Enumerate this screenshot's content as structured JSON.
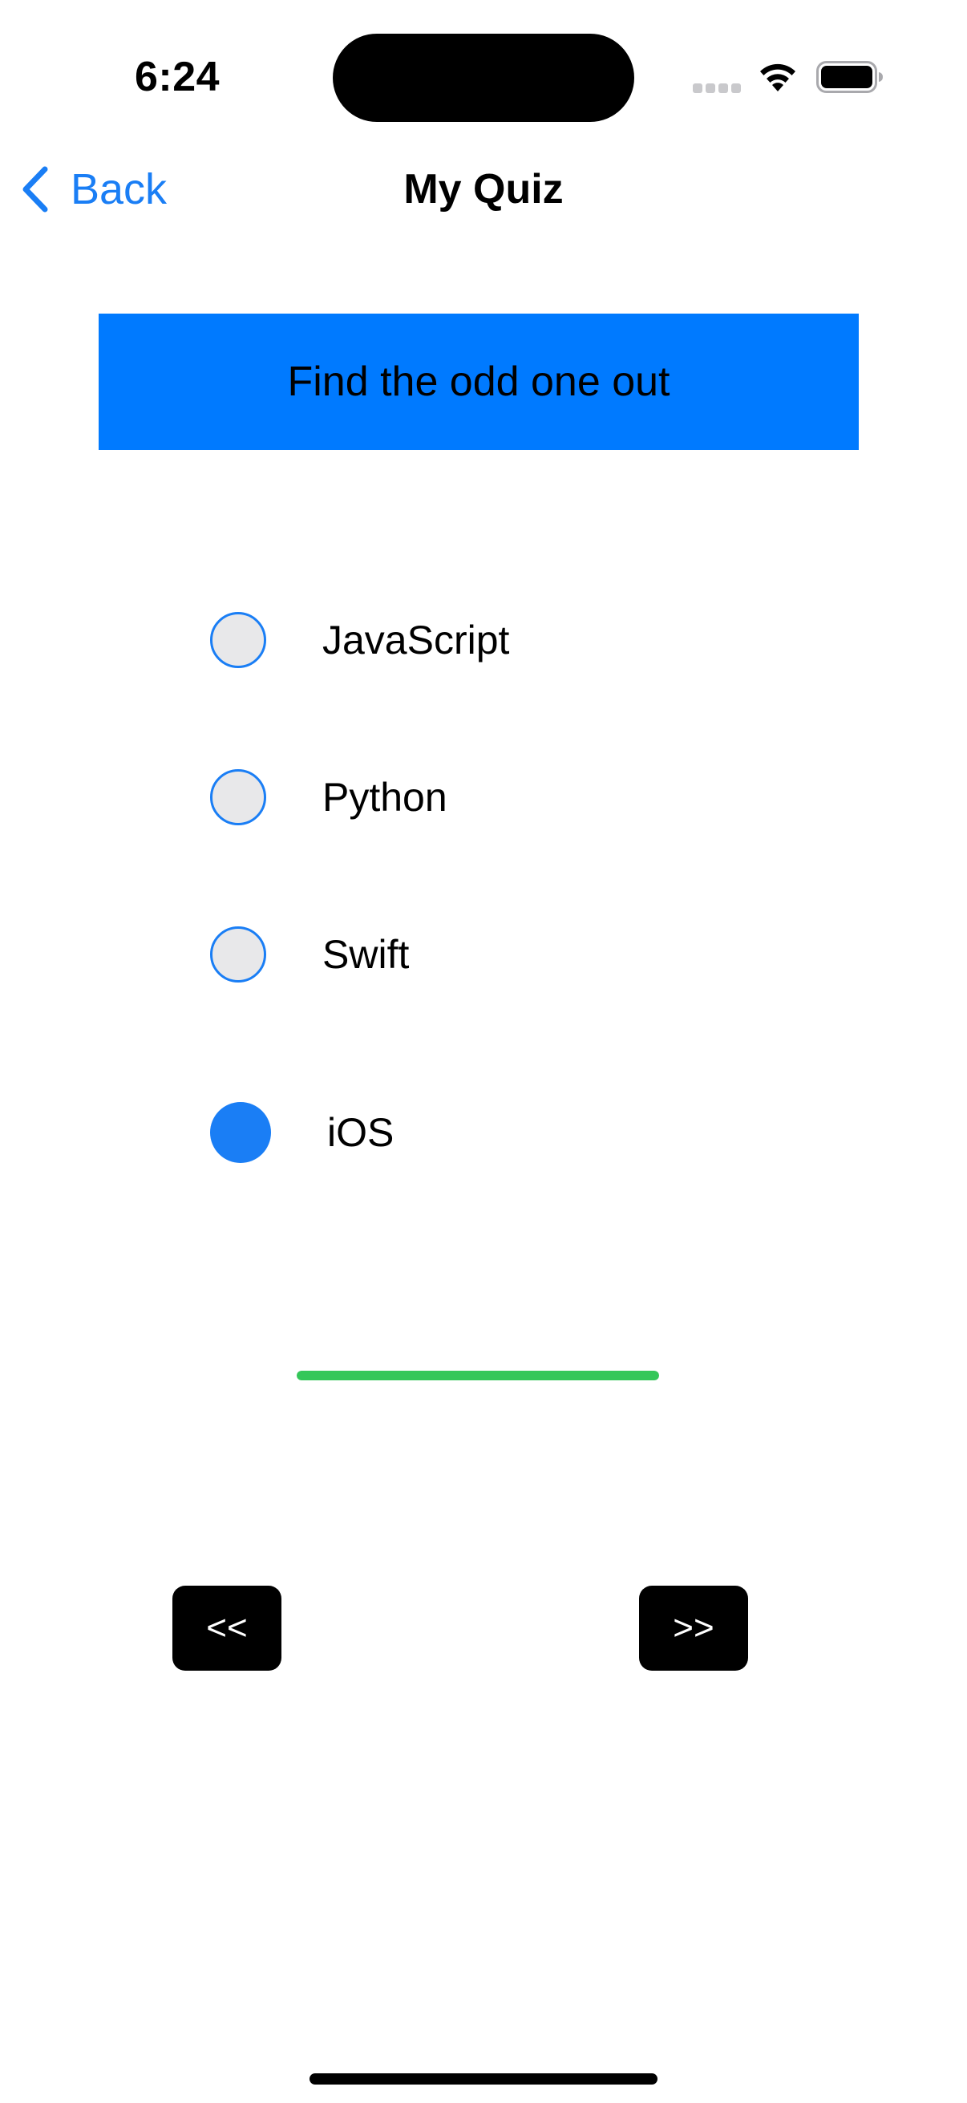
{
  "status_bar": {
    "time": "6:24",
    "icons": [
      "cellular-signal-icon",
      "wifi-icon",
      "battery-icon"
    ]
  },
  "nav": {
    "back_label": "Back",
    "title": "My Quiz"
  },
  "question": {
    "text": "Find the odd one out",
    "banner_color": "#007aff"
  },
  "options": [
    {
      "label": "JavaScript",
      "selected": false
    },
    {
      "label": "Python",
      "selected": false
    },
    {
      "label": "Swift",
      "selected": false
    },
    {
      "label": "iOS",
      "selected": true
    }
  ],
  "progress": {
    "fraction": 1.0,
    "color": "#34c759"
  },
  "pager": {
    "prev_label": "<<",
    "next_label": ">>"
  },
  "colors": {
    "accent": "#1a7ef5",
    "radio_unselected_fill": "#e8e8ea"
  }
}
